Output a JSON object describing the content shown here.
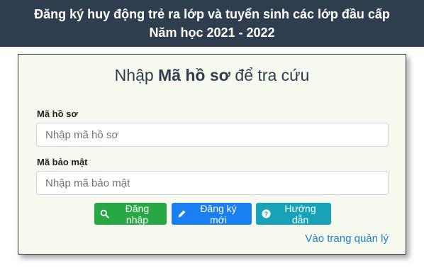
{
  "header": {
    "line1": "Đăng ký huy động trẻ ra lớp và tuyển sinh các lớp đầu cấp",
    "line2": "Năm học 2021 - 2022"
  },
  "form": {
    "title_prefix": "Nhập ",
    "title_bold": "Mã hồ sơ",
    "title_suffix": " để tra cứu",
    "profile_code_label": "Mã hồ sơ",
    "profile_code_placeholder": "Nhập mã hồ sơ",
    "profile_code_value": "",
    "security_code_label": "Mã bảo mật",
    "security_code_placeholder": "Nhập mã bảo mật",
    "security_code_value": ""
  },
  "buttons": {
    "login": {
      "label": "Đăng nhập",
      "icon": "search-icon",
      "color": "#28a745"
    },
    "register": {
      "label": "Đăng ký mới",
      "icon": "pencil-icon",
      "color": "#1a7ff0"
    },
    "help": {
      "label": "Hướng dẫn",
      "icon": "question-circle-icon",
      "color": "#17a2b8"
    }
  },
  "admin_link": "Vào trang quản lý",
  "colors": {
    "header_bg": "#2f3e4e",
    "card_bg": "#f6f9ee",
    "link": "#1a7fd6"
  }
}
